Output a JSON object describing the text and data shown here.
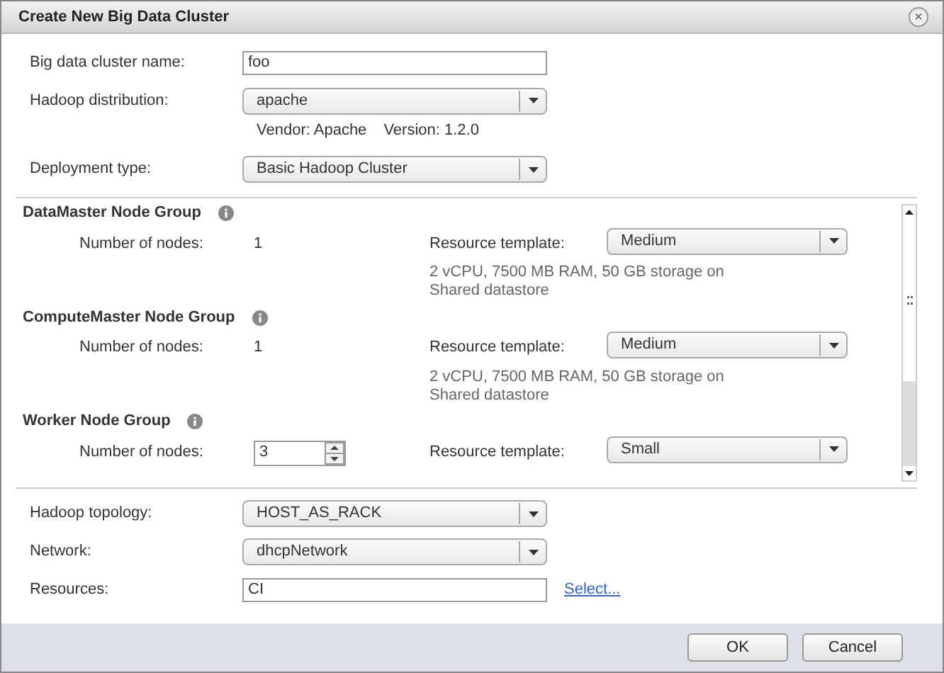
{
  "window": {
    "title": "Create New Big Data Cluster",
    "close": "×"
  },
  "fields": [
    {
      "kind": "text",
      "label": "Big data cluster name:",
      "value": "foo"
    },
    {
      "kind": "select",
      "label": "Hadoop distribution:",
      "value": "apache",
      "notes": [
        "Vendor: Apache",
        "Version: 1.2.0"
      ]
    },
    {
      "kind": "select",
      "label": "Deployment type:",
      "value": "Basic Hadoop Cluster"
    }
  ],
  "node_groups": [
    {
      "title": "DataMaster Node Group",
      "nodes_label": "Number of nodes:",
      "nodes": {
        "kind": "static",
        "value": "1"
      },
      "template_label": "Resource template:",
      "template": "Medium",
      "description": "2 vCPU, 7500 MB RAM, 50 GB storage on Shared datastore"
    },
    {
      "title": "ComputeMaster Node Group",
      "nodes_label": "Number of nodes:",
      "nodes": {
        "kind": "static",
        "value": "1"
      },
      "template_label": "Resource template:",
      "template": "Medium",
      "description": "2 vCPU, 7500 MB RAM, 50 GB storage on Shared datastore"
    },
    {
      "title": "Worker Node Group",
      "nodes_label": "Number of nodes:",
      "nodes": {
        "kind": "spinner",
        "value": "3"
      },
      "template_label": "Resource template:",
      "template": "Small"
    }
  ],
  "bottom_fields": [
    {
      "kind": "select",
      "label": "Hadoop topology:",
      "value": "HOST_AS_RACK"
    },
    {
      "kind": "select",
      "label": "Network:",
      "value": "dhcpNetwork"
    },
    {
      "kind": "text",
      "label": "Resources:",
      "value": "CI",
      "link": "Select..."
    }
  ],
  "buttons": [
    "OK",
    "Cancel"
  ]
}
